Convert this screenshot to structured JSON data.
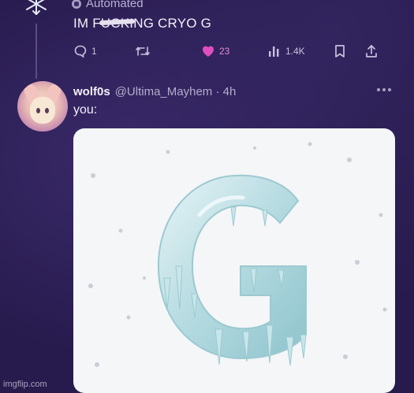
{
  "tweet": {
    "automated_label": "Automated",
    "text_before": "IM F",
    "text_hidden": "",
    "text_after": "NG CRYO G",
    "actions": {
      "replies": "1",
      "likes": "23",
      "views": "1.4K"
    },
    "like_color": "#e04fc0"
  },
  "reply": {
    "display_name": "wolf0s",
    "handle_time": "@Ultima_Mayhem · 4h",
    "text": "you:"
  },
  "media": {
    "image": "ice-letter-g",
    "background": "#f4f6f8"
  },
  "watermark": "imgflip.com"
}
